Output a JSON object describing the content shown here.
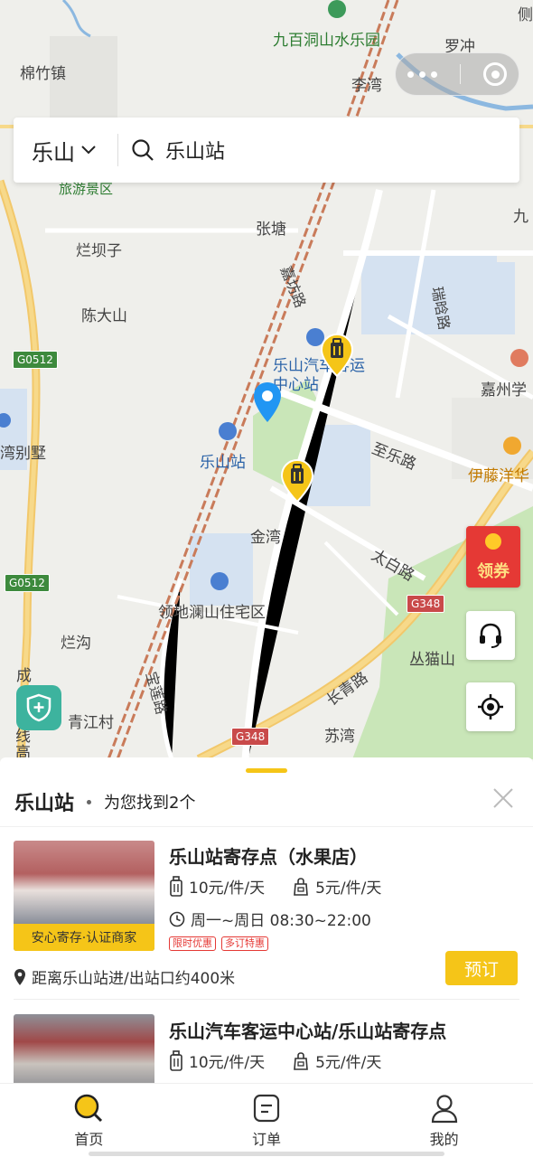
{
  "map": {
    "labels": [
      {
        "key": "mianzhu",
        "text": "棉竹镇"
      },
      {
        "key": "jiubai",
        "text": "九百洞山水乐园"
      },
      {
        "key": "luochong",
        "text": "罗冲"
      },
      {
        "key": "liwan",
        "text": "李湾"
      },
      {
        "key": "ce",
        "text": "侧"
      },
      {
        "key": "lvyou",
        "text": "旅游景区"
      },
      {
        "key": "zhangtang",
        "text": "张塘"
      },
      {
        "key": "jiu",
        "text": "九"
      },
      {
        "key": "lanbazi",
        "text": "烂坝子"
      },
      {
        "key": "jiaqiaolu",
        "text": "嘉坊路"
      },
      {
        "key": "ruiyanglu",
        "text": "瑞晗路"
      },
      {
        "key": "chendashan",
        "text": "陈大山"
      },
      {
        "key": "jiazhouxue",
        "text": "嘉州学"
      },
      {
        "key": "leshanqiche",
        "text": "乐山汽车客运中心站"
      },
      {
        "key": "wanbieshu",
        "text": "湾别墅"
      },
      {
        "key": "zhilelu",
        "text": "至乐路"
      },
      {
        "key": "leshanzhan",
        "text": "乐山站"
      },
      {
        "key": "yiteng",
        "text": "伊藤洋华"
      },
      {
        "key": "jinwan",
        "text": "金湾"
      },
      {
        "key": "taibailu",
        "text": "太白路"
      },
      {
        "key": "lingdi",
        "text": "领地澜山住宅区"
      },
      {
        "key": "langou",
        "text": "烂沟"
      },
      {
        "key": "congmaoshan",
        "text": "丛猫山"
      },
      {
        "key": "cheng",
        "text": "成"
      },
      {
        "key": "baolianlu",
        "text": "宝莲路"
      },
      {
        "key": "changqinglu",
        "text": "长青路"
      },
      {
        "key": "qingjiangcun",
        "text": "青江村"
      },
      {
        "key": "xian",
        "text": "线"
      },
      {
        "key": "gao",
        "text": "高"
      },
      {
        "key": "suwan",
        "text": "苏湾"
      }
    ],
    "road_badges": {
      "g0512_a": "G0512",
      "g0512_b": "G0512",
      "g348_a": "G348",
      "g348_b": "G348"
    },
    "pin_colors": {
      "selected": "#2196f3",
      "storage": "#f5c518"
    },
    "coupon_label": "领券"
  },
  "search": {
    "city": "乐山",
    "query": "乐山站"
  },
  "sheet": {
    "title": "乐山站",
    "subtitle": "为您找到2个",
    "stores": [
      {
        "name": "乐山站寄存点（水果店）",
        "price_luggage": "10元/件/天",
        "price_bag": "5元/件/天",
        "hours": "周一~周日 08:30~22:00",
        "badge": "安心寄存·认证商家",
        "tags": [
          "限时优惠",
          "多订特惠"
        ],
        "distance": "距离乐山站进/出站口约400米",
        "book": "预订"
      },
      {
        "name": "乐山汽车客运中心站/乐山站寄存点",
        "price_luggage": "10元/件/天",
        "price_bag": "5元/件/天"
      }
    ]
  },
  "tabs": [
    {
      "label": "首页",
      "icon": "search-icon"
    },
    {
      "label": "订单",
      "icon": "order-icon"
    },
    {
      "label": "我的",
      "icon": "user-icon"
    }
  ],
  "colors": {
    "accent": "#f5c518",
    "danger": "#e53935"
  }
}
